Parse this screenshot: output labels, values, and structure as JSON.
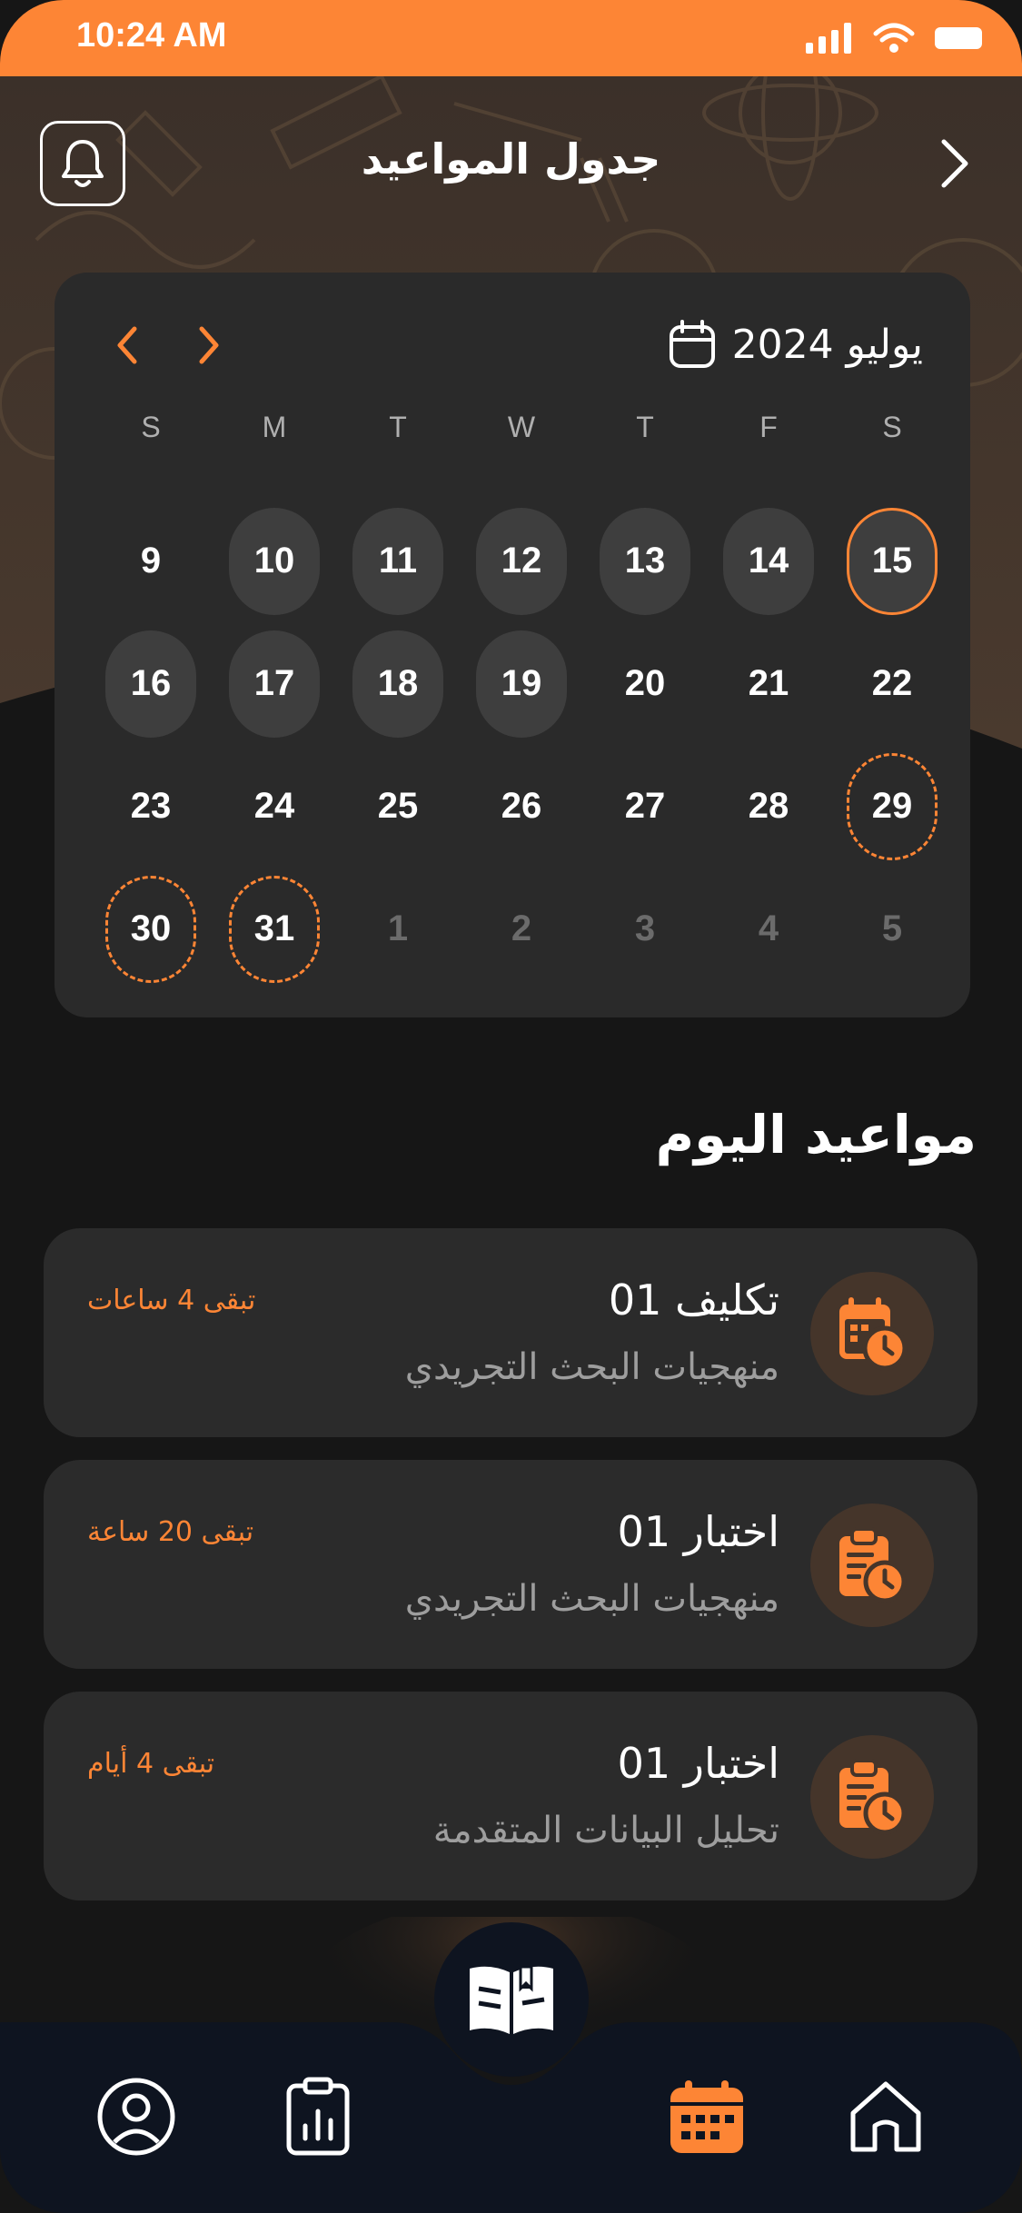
{
  "status_bar": {
    "time": "10:24 AM"
  },
  "header": {
    "title": "جدول المواعيد"
  },
  "calendar": {
    "month_label": "يوليو 2024",
    "weekdays": [
      "S",
      "M",
      "T",
      "W",
      "T",
      "F",
      "S"
    ],
    "rows": [
      [
        {
          "d": "9",
          "s": "plain"
        },
        {
          "d": "10",
          "s": "filled"
        },
        {
          "d": "11",
          "s": "filled"
        },
        {
          "d": "12",
          "s": "filled"
        },
        {
          "d": "13",
          "s": "filled"
        },
        {
          "d": "14",
          "s": "filled"
        },
        {
          "d": "15",
          "s": "today"
        }
      ],
      [
        {
          "d": "16",
          "s": "filled"
        },
        {
          "d": "17",
          "s": "filled"
        },
        {
          "d": "18",
          "s": "filled"
        },
        {
          "d": "19",
          "s": "filled"
        },
        {
          "d": "20",
          "s": "plain"
        },
        {
          "d": "21",
          "s": "plain"
        },
        {
          "d": "22",
          "s": "plain"
        }
      ],
      [
        {
          "d": "23",
          "s": "plain"
        },
        {
          "d": "24",
          "s": "plain"
        },
        {
          "d": "25",
          "s": "plain"
        },
        {
          "d": "26",
          "s": "plain"
        },
        {
          "d": "27",
          "s": "plain"
        },
        {
          "d": "28",
          "s": "plain"
        },
        {
          "d": "29",
          "s": "deadline"
        }
      ],
      [
        {
          "d": "30",
          "s": "deadline"
        },
        {
          "d": "31",
          "s": "deadline"
        },
        {
          "d": "1",
          "s": "muted"
        },
        {
          "d": "2",
          "s": "muted"
        },
        {
          "d": "3",
          "s": "muted"
        },
        {
          "d": "4",
          "s": "muted"
        },
        {
          "d": "5",
          "s": "muted"
        }
      ]
    ]
  },
  "today_section": {
    "title": "مواعيد اليوم"
  },
  "appointments": [
    {
      "title": "تكليف 01",
      "course": "منهجيات البحث التجريدي",
      "remaining": "تبقى 4 ساعات",
      "icon": "calendar-clock-icon"
    },
    {
      "title": "اختبار 01",
      "course": "منهجيات البحث التجريدي",
      "remaining": "تبقى 20 ساعة",
      "icon": "clipboard-clock-icon"
    },
    {
      "title": "اختبار 01",
      "course": "تحليل البيانات المتقدمة",
      "remaining": "تبقى 4 أيام",
      "icon": "clipboard-clock-icon"
    }
  ],
  "bottom_nav": {
    "items": [
      "profile-icon",
      "report-clipboard-icon",
      "open-book-icon",
      "calendar-icon",
      "home-icon"
    ],
    "active": "calendar-icon"
  },
  "colors": {
    "accent": "#FD8535",
    "card": "#2B2B2B",
    "background": "#161616",
    "nav": "#0E1420"
  }
}
